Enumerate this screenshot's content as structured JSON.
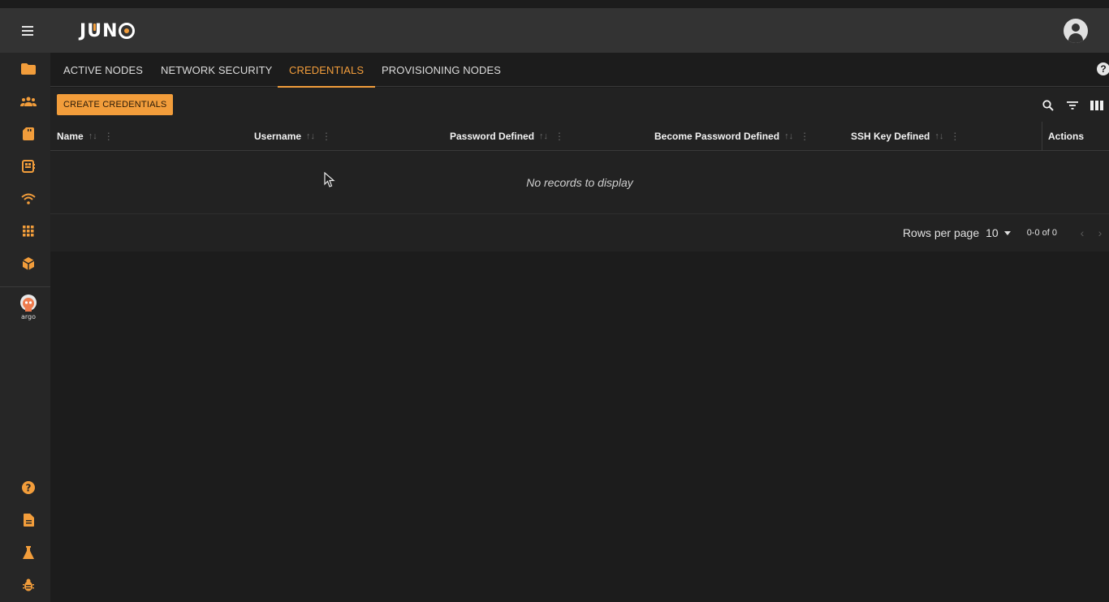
{
  "app": {
    "logo_text_j": "J",
    "logo_text_u": "U",
    "logo_text_n": "N"
  },
  "tabs": [
    {
      "label": "ACTIVE NODES",
      "active": false
    },
    {
      "label": "NETWORK SECURITY",
      "active": false
    },
    {
      "label": "CREDENTIALS",
      "active": true
    },
    {
      "label": "PROVISIONING NODES",
      "active": false
    }
  ],
  "toolbar": {
    "create_label": "CREATE CREDENTIALS",
    "icons": [
      "search-icon",
      "filter-icon",
      "columns-icon"
    ]
  },
  "table": {
    "columns": [
      {
        "label": "Name"
      },
      {
        "label": "Username"
      },
      {
        "label": "Password Defined"
      },
      {
        "label": "Become Password Defined"
      },
      {
        "label": "SSH Key Defined"
      },
      {
        "label": "Actions"
      }
    ],
    "empty_text": "No records to display"
  },
  "pagination": {
    "rows_per_page_label": "Rows per page",
    "rows_per_page_value": "10",
    "range_text": "0-0 of 0"
  },
  "sidebar": {
    "items": [
      "folder-icon",
      "groups-icon",
      "sd-card-icon",
      "board-icon",
      "wifi-icon",
      "grid-icon",
      "package-icon",
      "argo-icon",
      "help-icon",
      "document-icon",
      "flask-icon",
      "bug-icon"
    ]
  },
  "colors": {
    "accent": "#f29d3b",
    "topbar": "#333333",
    "background": "#1c1c1c"
  }
}
